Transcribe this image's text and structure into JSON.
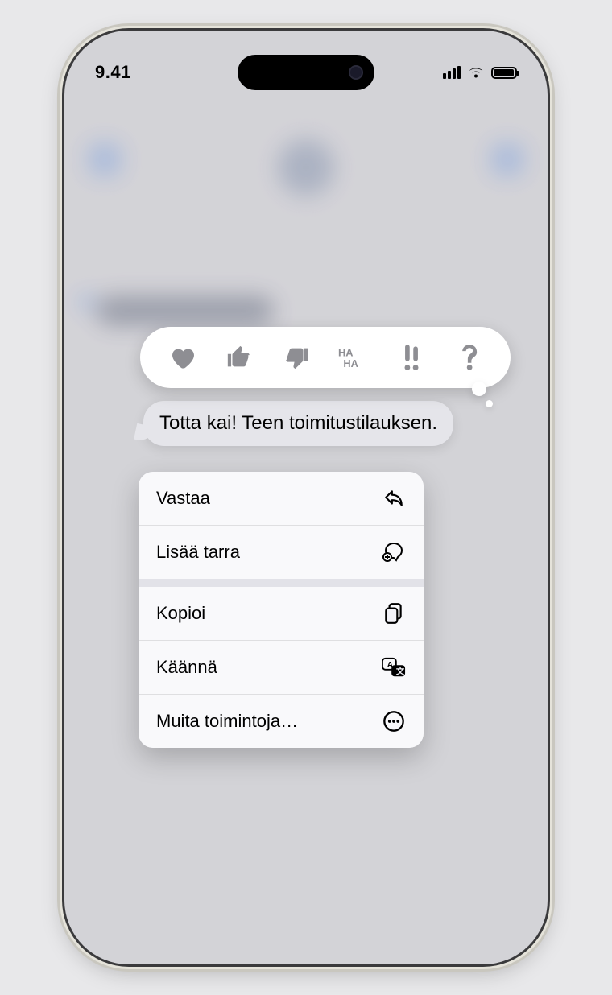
{
  "status": {
    "time": "9.41"
  },
  "tapbacks": [
    "heart",
    "thumbs-up",
    "thumbs-down",
    "haha",
    "exclaim",
    "question"
  ],
  "message": {
    "text": "Totta kai! Teen toimitustilauksen."
  },
  "menu": {
    "reply": "Vastaa",
    "sticker": "Lisää tarra",
    "copy": "Kopioi",
    "translate": "Käännä",
    "more": "Muita toimintoja…"
  }
}
